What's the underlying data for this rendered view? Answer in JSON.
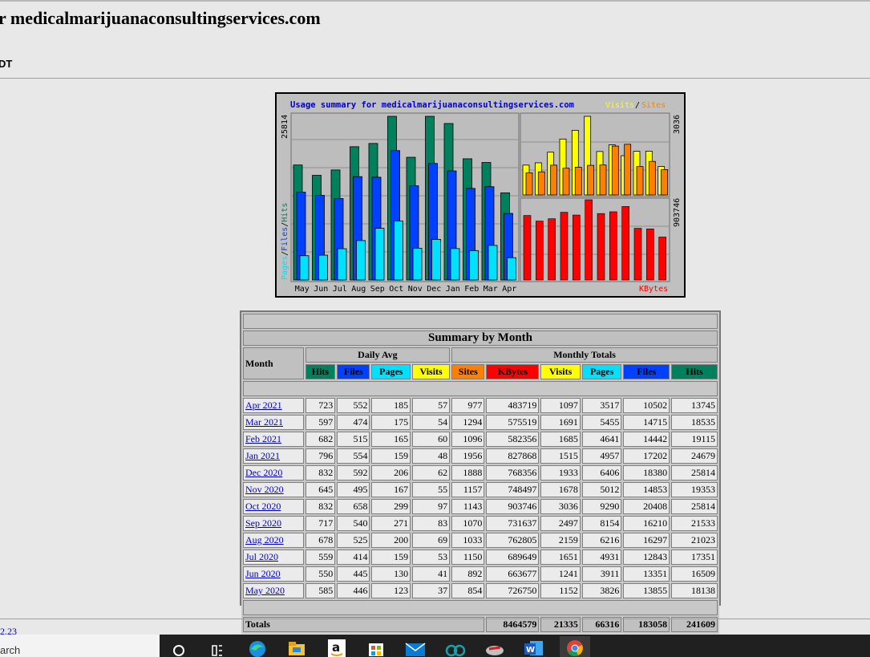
{
  "page": {
    "title": "r medicalmarijuanaconsultingservices.com",
    "subtitle": "DT",
    "footer_link": "2.23"
  },
  "chart_data": {
    "type": "bar",
    "title": "Usage summary for medicalmarijuanaconsultingservices.com",
    "legend_visits": "Visits",
    "legend_sep": "/",
    "legend_sites": "Sites",
    "left_axis_label": {
      "pages": "Pages",
      "sep1": "/",
      "files": "Files",
      "sep2": "/",
      "hits": "Hits"
    },
    "left_max_label": "25814",
    "right_top_max_label": "3036",
    "right_bottom_max_label": "903746",
    "kbytes_label": "KBytes",
    "categories": [
      "May",
      "Jun",
      "Jul",
      "Aug",
      "Sep",
      "Oct",
      "Nov",
      "Dec",
      "Jan",
      "Feb",
      "Mar",
      "Apr"
    ],
    "series": [
      {
        "name": "Hits",
        "color": "#00805c",
        "values": [
          18138,
          16509,
          17351,
          21023,
          21533,
          25814,
          19353,
          25814,
          24679,
          19115,
          18535,
          13745
        ]
      },
      {
        "name": "Files",
        "color": "#0040ff",
        "values": [
          13855,
          13351,
          12843,
          16297,
          16210,
          20408,
          14853,
          18380,
          17202,
          14442,
          14715,
          10502
        ]
      },
      {
        "name": "Pages",
        "color": "#00e0ff",
        "values": [
          3826,
          3911,
          4931,
          6216,
          8154,
          9290,
          5012,
          6406,
          4957,
          4641,
          5455,
          3517
        ]
      },
      {
        "name": "Visits",
        "color": "#ffff00",
        "values": [
          1152,
          1241,
          1651,
          2159,
          2497,
          3036,
          1678,
          1933,
          1515,
          1685,
          1691,
          1097
        ]
      },
      {
        "name": "Sites",
        "color": "#ff8000",
        "values": [
          854,
          892,
          1150,
          1033,
          1070,
          1143,
          1157,
          1888,
          1956,
          1096,
          1294,
          977
        ]
      },
      {
        "name": "KBytes",
        "color": "#ff0000",
        "values": [
          726750,
          663677,
          689649,
          762805,
          731637,
          903746,
          748497,
          768356,
          827868,
          582356,
          575519,
          483719
        ]
      }
    ]
  },
  "table": {
    "caption": "Summary by Month",
    "month_header": "Month",
    "daily_avg_header": "Daily Avg",
    "monthly_totals_header": "Monthly Totals",
    "daily_cols": [
      {
        "label": "Hits",
        "color": "#00805c"
      },
      {
        "label": "Files",
        "color": "#0040ff"
      },
      {
        "label": "Pages",
        "color": "#00e0ff"
      },
      {
        "label": "Visits",
        "color": "#ffff00"
      }
    ],
    "monthly_cols": [
      {
        "label": "Sites",
        "color": "#ff8000"
      },
      {
        "label": "KBytes",
        "color": "#ff0000"
      },
      {
        "label": "Visits",
        "color": "#ffff00"
      },
      {
        "label": "Pages",
        "color": "#00e0ff"
      },
      {
        "label": "Files",
        "color": "#0040ff"
      },
      {
        "label": "Hits",
        "color": "#00805c"
      }
    ],
    "rows": [
      {
        "month": "Apr 2021",
        "vals": [
          "723",
          "552",
          "185",
          "57",
          "977",
          "483719",
          "1097",
          "3517",
          "10502",
          "13745"
        ]
      },
      {
        "month": "Mar 2021",
        "vals": [
          "597",
          "474",
          "175",
          "54",
          "1294",
          "575519",
          "1691",
          "5455",
          "14715",
          "18535"
        ]
      },
      {
        "month": "Feb 2021",
        "vals": [
          "682",
          "515",
          "165",
          "60",
          "1096",
          "582356",
          "1685",
          "4641",
          "14442",
          "19115"
        ]
      },
      {
        "month": "Jan 2021",
        "vals": [
          "796",
          "554",
          "159",
          "48",
          "1956",
          "827868",
          "1515",
          "4957",
          "17202",
          "24679"
        ]
      },
      {
        "month": "Dec 2020",
        "vals": [
          "832",
          "592",
          "206",
          "62",
          "1888",
          "768356",
          "1933",
          "6406",
          "18380",
          "25814"
        ]
      },
      {
        "month": "Nov 2020",
        "vals": [
          "645",
          "495",
          "167",
          "55",
          "1157",
          "748497",
          "1678",
          "5012",
          "14853",
          "19353"
        ]
      },
      {
        "month": "Oct 2020",
        "vals": [
          "832",
          "658",
          "299",
          "97",
          "1143",
          "903746",
          "3036",
          "9290",
          "20408",
          "25814"
        ]
      },
      {
        "month": "Sep 2020",
        "vals": [
          "717",
          "540",
          "271",
          "83",
          "1070",
          "731637",
          "2497",
          "8154",
          "16210",
          "21533"
        ]
      },
      {
        "month": "Aug 2020",
        "vals": [
          "678",
          "525",
          "200",
          "69",
          "1033",
          "762805",
          "2159",
          "6216",
          "16297",
          "21023"
        ]
      },
      {
        "month": "Jul 2020",
        "vals": [
          "559",
          "414",
          "159",
          "53",
          "1150",
          "689649",
          "1651",
          "4931",
          "12843",
          "17351"
        ]
      },
      {
        "month": "Jun 2020",
        "vals": [
          "550",
          "445",
          "130",
          "41",
          "892",
          "663677",
          "1241",
          "3911",
          "13351",
          "16509"
        ]
      },
      {
        "month": "May 2020",
        "vals": [
          "585",
          "446",
          "123",
          "37",
          "854",
          "726750",
          "1152",
          "3826",
          "13855",
          "18138"
        ]
      }
    ],
    "totals_label": "Totals",
    "totals": [
      "8464579",
      "21335",
      "66316",
      "183058",
      "241609"
    ]
  },
  "taskbar": {
    "search_text": "arch",
    "icons": [
      "task-view-icon",
      "edge-browser-icon",
      "file-explorer-icon",
      "amazon-icon",
      "store-icon",
      "mail-icon",
      "arduino-icon",
      "app-icon",
      "word-icon",
      "chrome-icon"
    ]
  }
}
